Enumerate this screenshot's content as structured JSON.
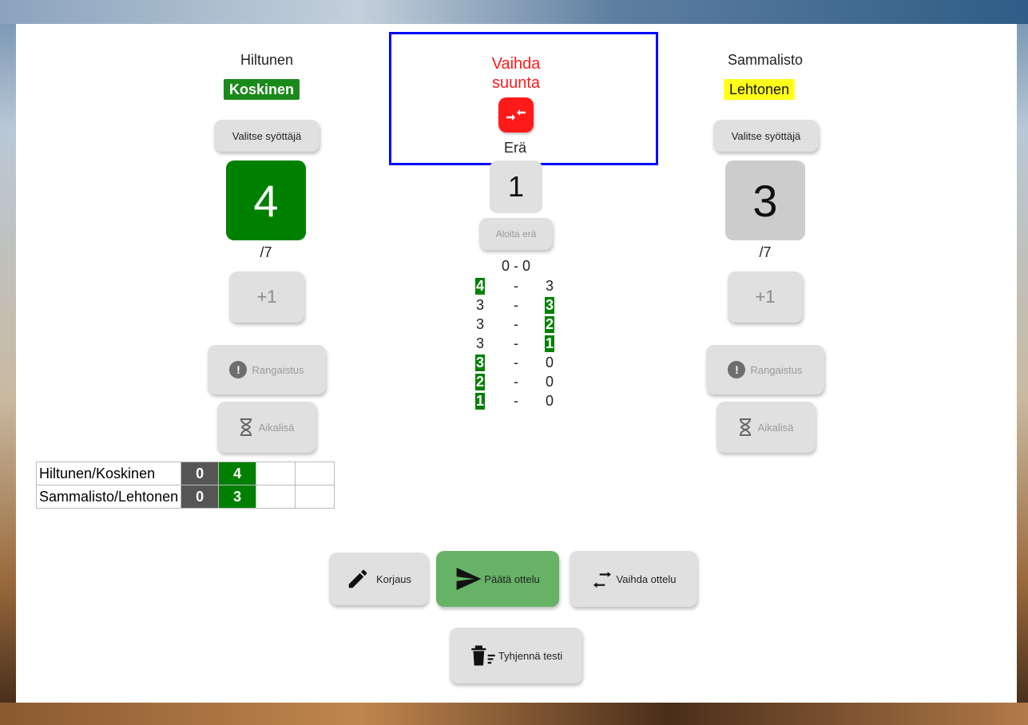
{
  "left_team": {
    "name": "Hiltunen",
    "tag": "Koskinen",
    "select_server_label": "Valitse syöttäjä",
    "score": "4",
    "max": "/7",
    "plus_label": "+1",
    "penalty_label": "Rangaistus",
    "timeout_label": "Aikalisä"
  },
  "right_team": {
    "name": "Sammalisto",
    "tag": "Lehtonen",
    "select_server_label": "Valitse syöttäjä",
    "score": "3",
    "max": "/7",
    "plus_label": "+1",
    "penalty_label": "Rangaistus",
    "timeout_label": "Aikalisä"
  },
  "center": {
    "switch_label_line1": "Vaihda",
    "switch_label_line2": "suunta",
    "round_label": "Erä",
    "round_number": "1",
    "start_round_label": "Aloita erä",
    "set_score": "0 - 0",
    "history": [
      {
        "left": "4",
        "sep": "-",
        "right": "3",
        "left_hi": true,
        "right_hi": false
      },
      {
        "left": "3",
        "sep": "-",
        "right": "3",
        "left_hi": false,
        "right_hi": true
      },
      {
        "left": "3",
        "sep": "-",
        "right": "2",
        "left_hi": false,
        "right_hi": true
      },
      {
        "left": "3",
        "sep": "-",
        "right": "1",
        "left_hi": false,
        "right_hi": true
      },
      {
        "left": "3",
        "sep": "-",
        "right": "0",
        "left_hi": true,
        "right_hi": false
      },
      {
        "left": "2",
        "sep": "-",
        "right": "0",
        "left_hi": true,
        "right_hi": false
      },
      {
        "left": "1",
        "sep": "-",
        "right": "0",
        "left_hi": true,
        "right_hi": false
      }
    ]
  },
  "tally": {
    "rows": [
      {
        "team": "Hiltunen/Koskinen",
        "sets": "0",
        "current": "4"
      },
      {
        "team": "Sammalisto/Lehtonen",
        "sets": "0",
        "current": "3"
      }
    ]
  },
  "actions": {
    "correction_label": "Korjaus",
    "end_match_label": "Päätä ottelu",
    "change_match_label": "Vaihda ottelu",
    "clear_test_label": "Tyhjennä testi"
  },
  "colors": {
    "green": "#008000",
    "end_match_green": "#66b266",
    "switch_red": "#ff1a1a",
    "highlight_blue": "#0000ff",
    "tag_yellow": "#ffff1a"
  },
  "icons": [
    "alert-icon",
    "hourglass-icon",
    "swap-direction-icon",
    "pencil-icon",
    "send-icon",
    "swap-horiz-icon",
    "delete-sweep-icon"
  ]
}
